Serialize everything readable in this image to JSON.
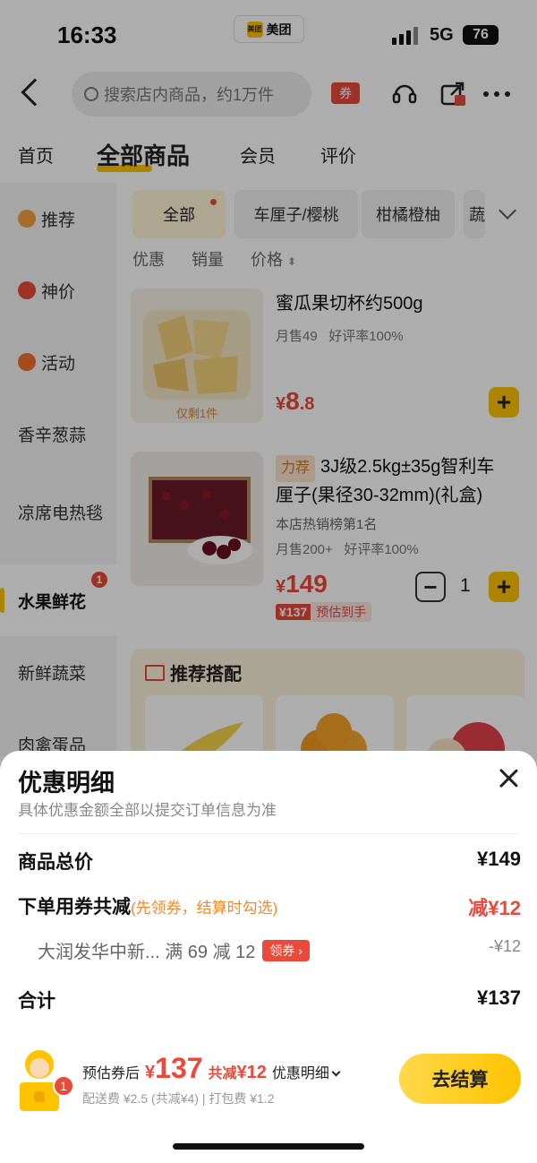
{
  "status": {
    "time": "16:33",
    "app_name": "美团",
    "app_logo_text": "美团",
    "network": "5G",
    "battery": "76"
  },
  "search": {
    "placeholder": "搜索店内商品，约1万件",
    "coupon_label": "券"
  },
  "nav": {
    "tabs": [
      "首页",
      "全部商品",
      "会员",
      "评价"
    ],
    "active": 1
  },
  "sidebar": {
    "items": [
      {
        "label": "推荐",
        "icon": "thumb-icon"
      },
      {
        "label": "神价",
        "icon": "lightning-icon"
      },
      {
        "label": "活动",
        "icon": "pin-icon"
      },
      {
        "label": "香辛葱蒜"
      },
      {
        "label": "凉席电热毯"
      },
      {
        "label": "水果鲜花",
        "badge": "1"
      },
      {
        "label": "新鲜蔬菜"
      },
      {
        "label": "肉禽蛋品"
      }
    ]
  },
  "chips": [
    "全部",
    "车厘子/樱桃",
    "柑橘橙柚",
    "蔬"
  ],
  "sorts": [
    "优惠",
    "销量",
    "价格"
  ],
  "products": [
    {
      "name": "蜜瓜果切杯约500g",
      "sales": "月售49",
      "rating": "好评率100%",
      "price_int": "8",
      "price_dec": ".8",
      "currency": "¥",
      "stock_note": "仅剩1件",
      "add": "+"
    },
    {
      "tag": "力荐",
      "name_line1": "3J级2.5kg±35g智利车",
      "name_line2": "厘子(果径30-32mm)(礼盒)",
      "rank": "本店热销榜第1名",
      "sales": "月售200+",
      "rating": "好评率100%",
      "currency": "¥",
      "price": "149",
      "est_price": "¥137",
      "est_label": "预估到手",
      "qty": "1",
      "minus": "−",
      "add": "+"
    }
  ],
  "recommend": {
    "title": "推荐搭配"
  },
  "sheet": {
    "title": "优惠明细",
    "subtitle": "具体优惠金额全部以提交订单信息为准",
    "rows": {
      "subtotal_label": "商品总价",
      "subtotal_value": "¥149",
      "coupon_label": "下单用券共减",
      "coupon_hint": "(先领券，结算时勾选)",
      "coupon_value": "减¥12",
      "store_coupon_label": "大润发华中新... 满 69 减 12",
      "get_coupon": "领券",
      "store_coupon_value": "-¥12",
      "total_label": "合计",
      "total_value": "¥137"
    }
  },
  "bottom": {
    "est_label": "预估券后",
    "currency": "¥",
    "est_total": "137",
    "saved_label": "共减",
    "saved_value": "¥12",
    "detail_label": "优惠明细",
    "fees": "配送费 ¥2.5 (共减¥4) | 打包费 ¥1.2",
    "cart_badge": "1",
    "checkout": "去结算"
  },
  "colors": {
    "accent": "#ffc300",
    "price_red": "#e94a3a",
    "hint_orange": "#f08a2a"
  }
}
